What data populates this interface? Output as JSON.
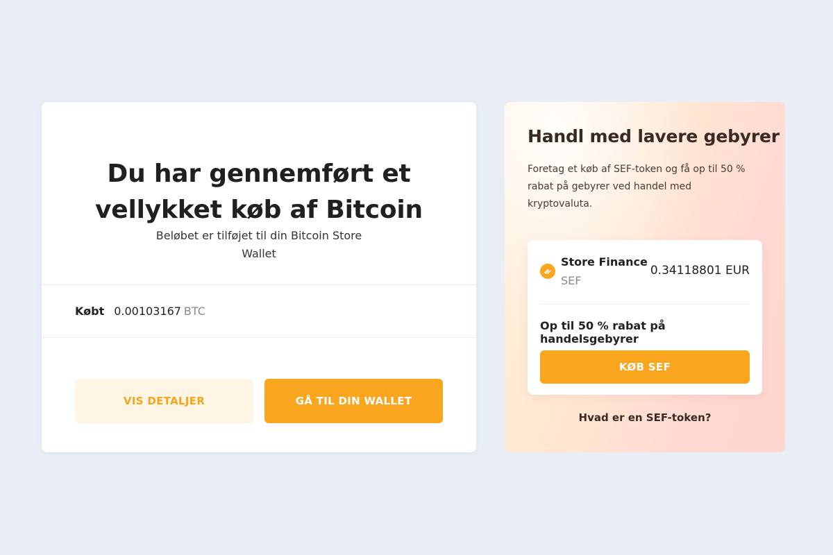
{
  "success_card": {
    "title": "Du har gennemført et vellykket køb af Bitcoin",
    "subtitle": "Beløbet er tilføjet til din Bitcoin Store Wallet",
    "bought_label": "Købt",
    "bought_amount": "0.00103167",
    "bought_unit": "BTC",
    "details_button": "VIS DETALJER",
    "wallet_button": "GÅ TIL DIN WALLET"
  },
  "promo_card": {
    "title": "Handl med lavere gebyrer",
    "description": "Foretag et køb af SEF-token og få op til 50 % rabat på gebyrer ved handel med kryptovaluta.",
    "token": {
      "name": "Store Finance",
      "symbol": "SEF",
      "price": "0.34118801 EUR",
      "icon": "store-finance-token-icon"
    },
    "discount_text": "Op til 50 % rabat på handelsgebyrer",
    "buy_button": "KØB SEF",
    "info_link": "Hvad er en SEF-token?"
  },
  "colors": {
    "accent": "#f9a51e",
    "accent_light": "#fef5e5",
    "page_background": "#e8eef4"
  }
}
